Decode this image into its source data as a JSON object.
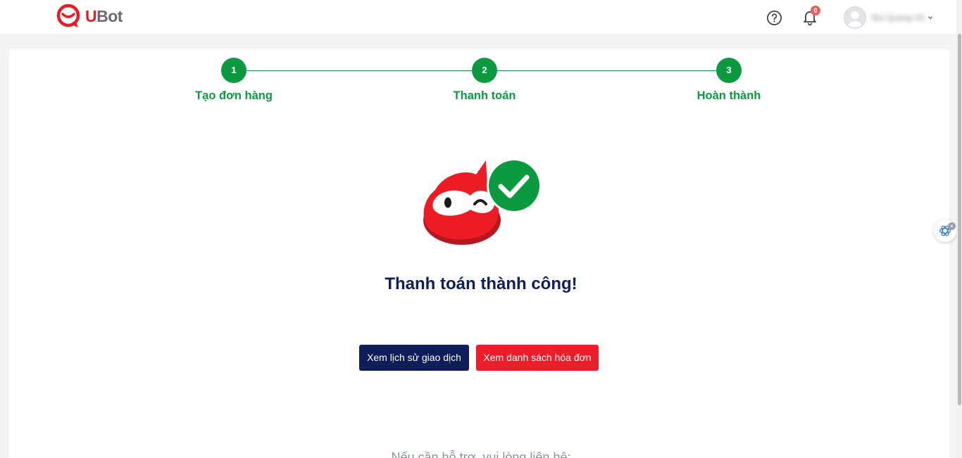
{
  "header": {
    "logo_text": "UBot",
    "notification_count": "0",
    "user_name": "Bùi Quang Vũ",
    "icons": {
      "help": "help-circle-icon",
      "bell": "bell-icon",
      "avatar": "user-avatar-icon",
      "chevron": "chevron-down-icon"
    }
  },
  "steps": [
    {
      "number": "1",
      "label": "Tạo đơn hàng"
    },
    {
      "number": "2",
      "label": "Thanh toán"
    },
    {
      "number": "3",
      "label": "Hoàn thành"
    }
  ],
  "main": {
    "title": "Thanh toán thành công!",
    "view_history_button": "Xem lịch sử giao dịch",
    "view_invoices_button": "Xem danh sách hóa đơn",
    "support_text": "Nếu cần hỗ trợ, vui lòng liên hệ:"
  },
  "colors": {
    "brand_red": "#e41e26",
    "step_green": "#0b9a3f",
    "navy": "#0f1e5a",
    "button_red": "#ee1d2a"
  },
  "widget": {
    "icon": "openai-icon",
    "close_icon": "close-icon"
  }
}
